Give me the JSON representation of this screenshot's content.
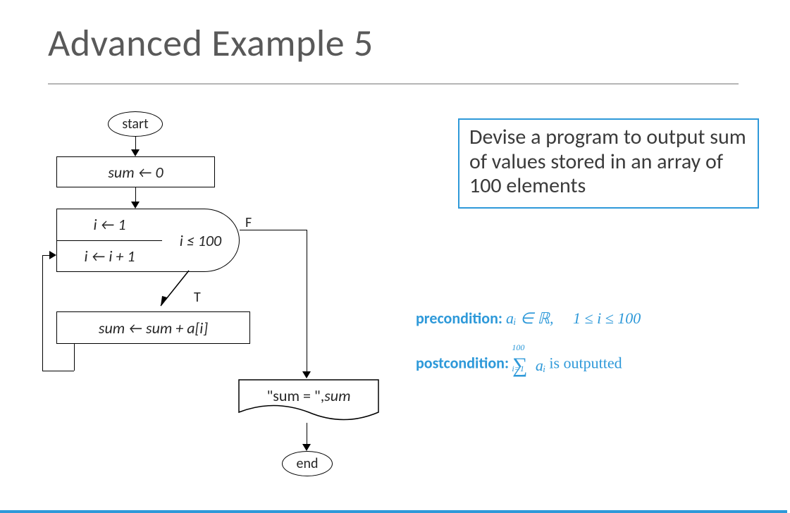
{
  "title": "Advanced Example 5",
  "description": "Devise a program to output sum of values stored in an array of 100 elements",
  "precondition": {
    "label": "precondition:",
    "expr": "aᵢ ∈ ℝ,  1 ≤ i ≤ 100"
  },
  "postcondition": {
    "label": "postcondition:",
    "sum_lower": "i=1",
    "sum_upper": "100",
    "term": "aᵢ",
    "tail": " is outputted"
  },
  "flow": {
    "start": "start",
    "init_sum": "sum ← 0",
    "loop_init": "i ← 1",
    "loop_step": "i ← i + 1",
    "loop_cond": "i ≤ 100",
    "f_label": "F",
    "t_label": "T",
    "body": "sum ← sum + a[i]",
    "output_prefix": "\"sum = \", ",
    "output_var": "sum",
    "end": "end"
  }
}
